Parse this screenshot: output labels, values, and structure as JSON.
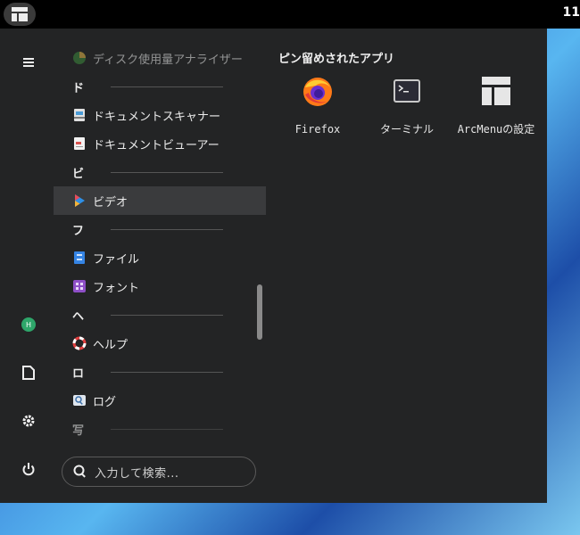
{
  "topbar": {
    "clock": "11"
  },
  "menu": {
    "list": [
      {
        "kind": "app",
        "label": "ディスク使用量アナライザー",
        "icon": "disk-usage-icon",
        "faded": true
      },
      {
        "kind": "header",
        "letter": "ド"
      },
      {
        "kind": "app",
        "label": "ドキュメントスキャナー",
        "icon": "document-scanner-icon"
      },
      {
        "kind": "app",
        "label": "ドキュメントビューアー",
        "icon": "document-viewer-icon"
      },
      {
        "kind": "header",
        "letter": "ビ"
      },
      {
        "kind": "app",
        "label": "ビデオ",
        "icon": "video-icon",
        "selected": true
      },
      {
        "kind": "header",
        "letter": "フ"
      },
      {
        "kind": "app",
        "label": "ファイル",
        "icon": "files-icon"
      },
      {
        "kind": "app",
        "label": "フォント",
        "icon": "fonts-icon"
      },
      {
        "kind": "header",
        "letter": "ヘ"
      },
      {
        "kind": "app",
        "label": "ヘルプ",
        "icon": "help-icon"
      },
      {
        "kind": "header",
        "letter": "ロ"
      },
      {
        "kind": "app",
        "label": "ログ",
        "icon": "logs-icon"
      },
      {
        "kind": "header",
        "letter": "写",
        "faded": true
      }
    ],
    "search": {
      "placeholder": "入力して検索..."
    },
    "pinned": {
      "title": "ピン留めされたアプリ",
      "apps": [
        {
          "label": "Firefox",
          "icon": "firefox-icon"
        },
        {
          "label": "ターミナル",
          "icon": "terminal-icon"
        },
        {
          "label": "ArcMenuの設定",
          "icon": "arcmenu-settings-icon"
        }
      ]
    },
    "sidebar": [
      "hamburger-icon",
      "user-avatar",
      "documents-icon",
      "settings-icon",
      "power-icon"
    ],
    "avatar_initial": "H"
  }
}
